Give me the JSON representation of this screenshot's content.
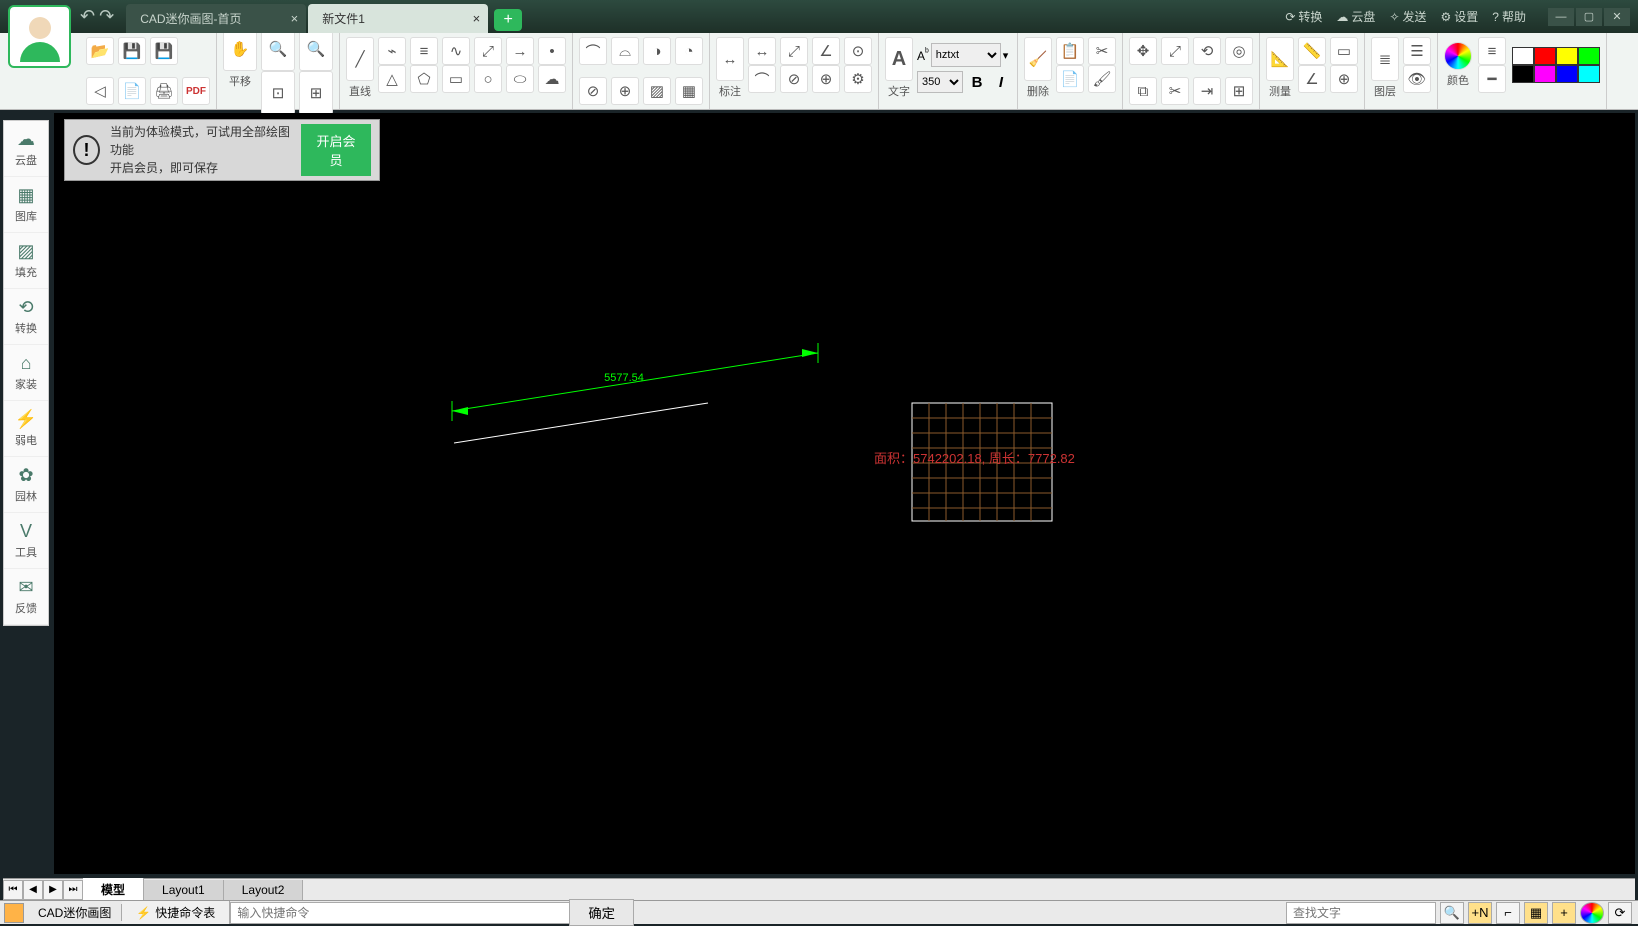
{
  "titlebar": {
    "tabs": [
      {
        "label": "CAD迷你画图-首页",
        "active": false
      },
      {
        "label": "新文件1",
        "active": true
      }
    ],
    "menu": {
      "convert": "转换",
      "cloud": "云盘",
      "send": "发送",
      "settings": "设置",
      "help": "帮助"
    }
  },
  "ribbon": {
    "pan": "平移",
    "line": "直线",
    "dimension": "标注",
    "text": "文字",
    "font": "hztxt",
    "fontsize": "350",
    "delete": "删除",
    "measure": "测量",
    "layer": "图层",
    "color": "颜色"
  },
  "sidebar": {
    "items": [
      {
        "icon": "☁",
        "label": "云盘"
      },
      {
        "icon": "▦",
        "label": "图库"
      },
      {
        "icon": "▨",
        "label": "填充"
      },
      {
        "icon": "⟲",
        "label": "转换"
      },
      {
        "icon": "⌂",
        "label": "家装"
      },
      {
        "icon": "⚡",
        "label": "弱电"
      },
      {
        "icon": "✿",
        "label": "园林"
      },
      {
        "icon": "V",
        "label": "工具"
      },
      {
        "icon": "✉",
        "label": "反馈"
      }
    ]
  },
  "notice": {
    "line1": "当前为体验模式，可试用全部绘图功能",
    "line2": "开启会员，即可保存",
    "button": "开启会员"
  },
  "drawing": {
    "dimension_value": "5577.54",
    "annotation": "面积：5742202.18, 周长：7772.82"
  },
  "bottom_tabs": {
    "model": "模型",
    "layout1": "Layout1",
    "layout2": "Layout2"
  },
  "statusbar": {
    "title": "CAD迷你画图",
    "cmdref": "快捷命令表",
    "cmd_placeholder": "输入快捷命令",
    "ok": "确定",
    "search_placeholder": "查找文字"
  },
  "colors": [
    "#ffffff",
    "#ff0000",
    "#ffff00",
    "#00ff00",
    "#000000",
    "#ff00ff",
    "#0000ff",
    "#00ffff"
  ]
}
